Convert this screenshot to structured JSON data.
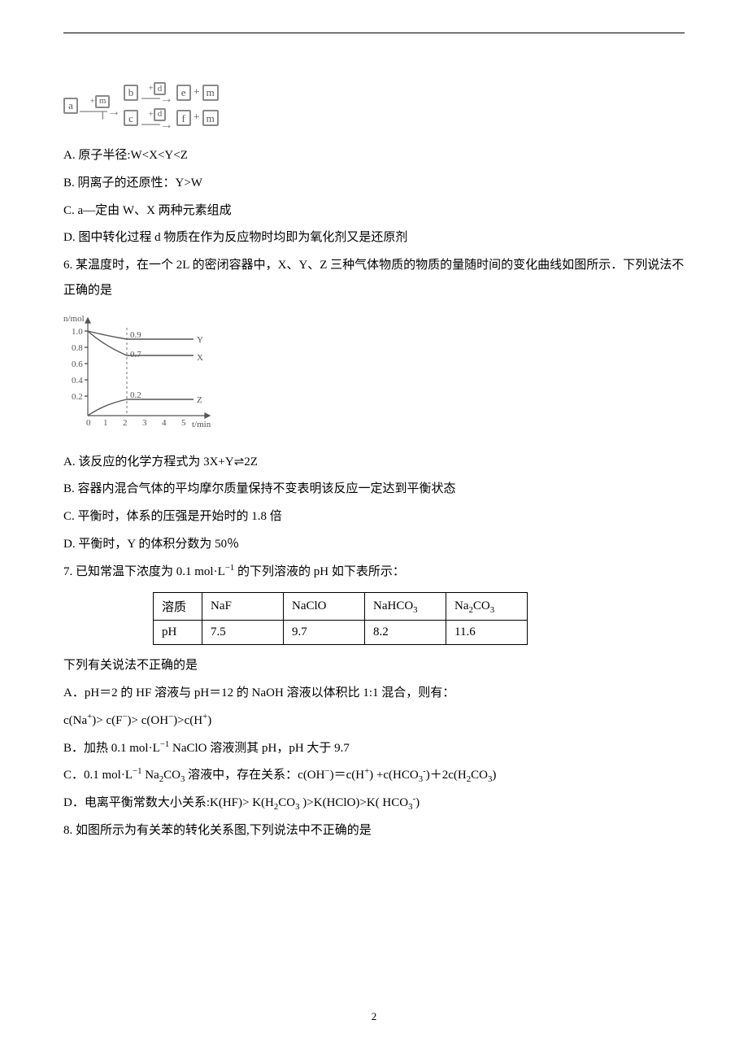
{
  "diagram5": {
    "a": "a",
    "b": "b",
    "c": "c",
    "d": "d",
    "e": "e",
    "f": "f",
    "m": "m"
  },
  "q5": {
    "A": "A. 原子半径:W<X<Y<Z",
    "B": "B. 阴离子的还原性：Y>W",
    "C": "C. a—定由 W、X 两种元素组成",
    "D": "D. 图中转化过程 d 物质在作为反应物时均即为氧化剂又是还原剂"
  },
  "q6": {
    "stem": "6. 某温度时，在一个 2L 的密闭容器中，X、Y、Z 三种气体物质的物质的量随时间的变化曲线如图所示．下列说法不正确的是",
    "A": "A. 该反应的化学方程式为 3X+Y⇌2Z",
    "B": "B. 容器内混合气体的平均摩尔质量保持不变表明该反应一定达到平衡状态",
    "C": "C. 平衡时，体系的压强是开始时的 1.8 倍",
    "D": "D. 平衡时，Y 的体积分数为 50％"
  },
  "chart_data": {
    "type": "line",
    "title": "",
    "xlabel": "t/min",
    "ylabel": "n/mol",
    "xticks": [
      0,
      1,
      2,
      3,
      4,
      5
    ],
    "yticks": [
      0.2,
      0.4,
      0.6,
      0.8,
      1.0
    ],
    "xlim": [
      0,
      5.5
    ],
    "ylim": [
      0,
      1.1
    ],
    "annotations": [
      {
        "x": 2,
        "y": 0.9,
        "text": "0.9"
      },
      {
        "x": 2,
        "y": 0.7,
        "text": "0.7"
      },
      {
        "x": 2,
        "y": 0.2,
        "text": "0.2"
      }
    ],
    "series": [
      {
        "name": "Y",
        "x": [
          0,
          0.5,
          1,
          1.5,
          2,
          3,
          4,
          5
        ],
        "y": [
          1.0,
          0.96,
          0.93,
          0.91,
          0.9,
          0.9,
          0.9,
          0.9
        ]
      },
      {
        "name": "X",
        "x": [
          0,
          0.5,
          1,
          1.5,
          2,
          3,
          4,
          5
        ],
        "y": [
          1.0,
          0.88,
          0.79,
          0.73,
          0.7,
          0.7,
          0.7,
          0.7
        ]
      },
      {
        "name": "Z",
        "x": [
          0,
          0.5,
          1,
          1.5,
          2,
          3,
          4,
          5
        ],
        "y": [
          0.0,
          0.08,
          0.14,
          0.18,
          0.2,
          0.2,
          0.2,
          0.2
        ]
      }
    ]
  },
  "q7": {
    "stem_pre": "7. 已知常温下浓度为 0.1 mol·L",
    "stem_sup": "−1",
    "stem_post": " 的下列溶液的 pH 如下表所示：",
    "table": {
      "head": [
        "溶质",
        "NaF",
        "NaClO",
        "NaHCO₃",
        "Na₂CO₃"
      ],
      "row": [
        "pH",
        "7.5",
        "9.7",
        "8.2",
        "11.6"
      ]
    },
    "below": "下列有关说法不正确的是",
    "A": "A．pH＝2 的 HF 溶液与 pH＝12 的 NaOH 溶液以体积比 1:1 混合，则有：",
    "A2_pre": "c(Na",
    "A2_sup1": "+",
    "A2_mid1": ")> c(F",
    "A2_sup2": "−",
    "A2_mid2": ")> c(OH",
    "A2_sup3": "−",
    "A2_mid3": ")>c(H",
    "A2_sup4": "+",
    "A2_end": ")",
    "B_pre": "B．加热 0.1 mol·L",
    "B_sup": "−1",
    "B_post": " NaClO 溶液测其 pH，pH 大于 9.7",
    "C_pre": "C．0.1 mol·L",
    "C_sup": "−1",
    "C_mid1": " Na",
    "C_sub2": "2",
    "C_mid1b": "CO",
    "C_sub3": "3",
    "C_mid2": " 溶液中，存在关系：c(OH",
    "C_sup2": "−",
    "C_mid3": ")＝c(H",
    "C_sup3": "+",
    "C_mid4": ") +c(HCO",
    "C_sub4": "3",
    "C_sup4": "-",
    "C_mid5": ")＋2c(H",
    "C_sub5": "2",
    "C_mid6": "CO",
    "C_sub6": "3",
    "C_end": ")",
    "D_pre": "D．电离平衡常数大小关系:K(HF)> K(H",
    "D_sub1": "2",
    "D_mid1": "CO",
    "D_sub2": "3",
    "D_mid2": " )>K(HClO)>K( HCO",
    "D_sub3": "3",
    "D_sup1": "-",
    "D_end": ")"
  },
  "q8": {
    "stem": "8. 如图所示为有关苯的转化关系图,下列说法中不正确的是"
  },
  "page_number": "2"
}
